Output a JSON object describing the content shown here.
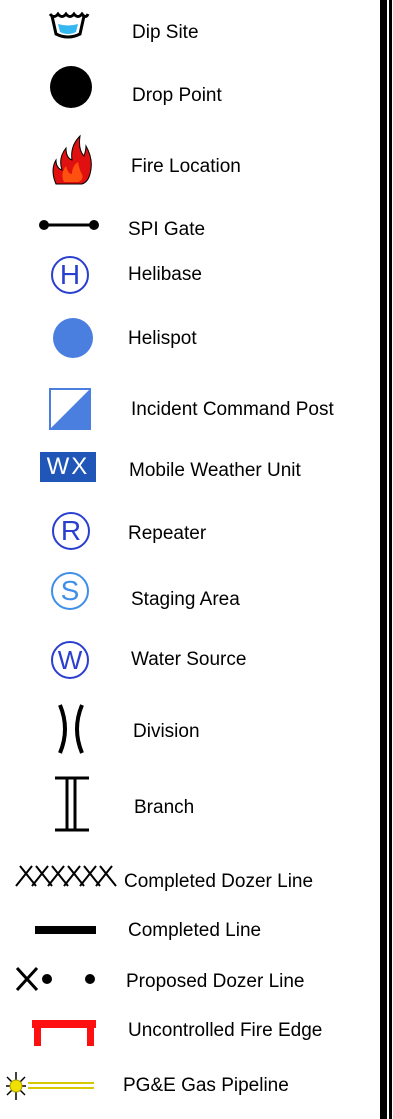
{
  "legend": {
    "items": [
      {
        "key": "dip_site",
        "label": "Dip Site",
        "icon": "dip-site-icon"
      },
      {
        "key": "drop_point",
        "label": "Drop Point",
        "icon": "filled-circle-icon"
      },
      {
        "key": "fire_location",
        "label": "Fire Location",
        "icon": "flame-icon"
      },
      {
        "key": "spi_gate",
        "label": "SPI Gate",
        "icon": "gate-line-icon"
      },
      {
        "key": "helibase",
        "label": "Helibase",
        "icon": "circled-h-icon",
        "letter": "H"
      },
      {
        "key": "helispot",
        "label": "Helispot",
        "icon": "blue-dot-icon"
      },
      {
        "key": "incident_command_post",
        "label": "Incident Command Post",
        "icon": "command-post-icon"
      },
      {
        "key": "mobile_weather_unit",
        "label": "Mobile Weather Unit",
        "icon": "wx-badge-icon",
        "badge": "WX"
      },
      {
        "key": "repeater",
        "label": "Repeater",
        "icon": "circled-r-icon",
        "letter": "R"
      },
      {
        "key": "staging_area",
        "label": "Staging Area",
        "icon": "circled-s-icon",
        "letter": "S"
      },
      {
        "key": "water_source",
        "label": "Water Source",
        "icon": "circled-w-icon",
        "letter": "W"
      },
      {
        "key": "division",
        "label": "Division",
        "icon": "division-break-icon"
      },
      {
        "key": "branch",
        "label": "Branch",
        "icon": "branch-break-icon"
      },
      {
        "key": "completed_dozer_line",
        "label": "Completed Dozer Line",
        "icon": "crosshatch-line-icon"
      },
      {
        "key": "completed_line",
        "label": "Completed Line",
        "icon": "solid-line-icon"
      },
      {
        "key": "proposed_dozer_line",
        "label": "Proposed Dozer Line",
        "icon": "x-dot-line-icon"
      },
      {
        "key": "uncontrolled_fire_edge",
        "label": "Uncontrolled Fire Edge",
        "icon": "fire-edge-icon"
      },
      {
        "key": "pge_gas_pipeline",
        "label": "PG&E Gas Pipeline",
        "icon": "gas-pipeline-icon"
      }
    ]
  },
  "colors": {
    "blue_dot": "#4a7fe0",
    "circle_blue": "#2a3fd0",
    "staging_blue": "#3f8fe8",
    "wx_blue": "#1f56b8",
    "fire_red": "#e01010",
    "edge_red": "#ff1010",
    "pipeline_yellow": "#f0e000",
    "dip_water": "#35b8f0"
  }
}
